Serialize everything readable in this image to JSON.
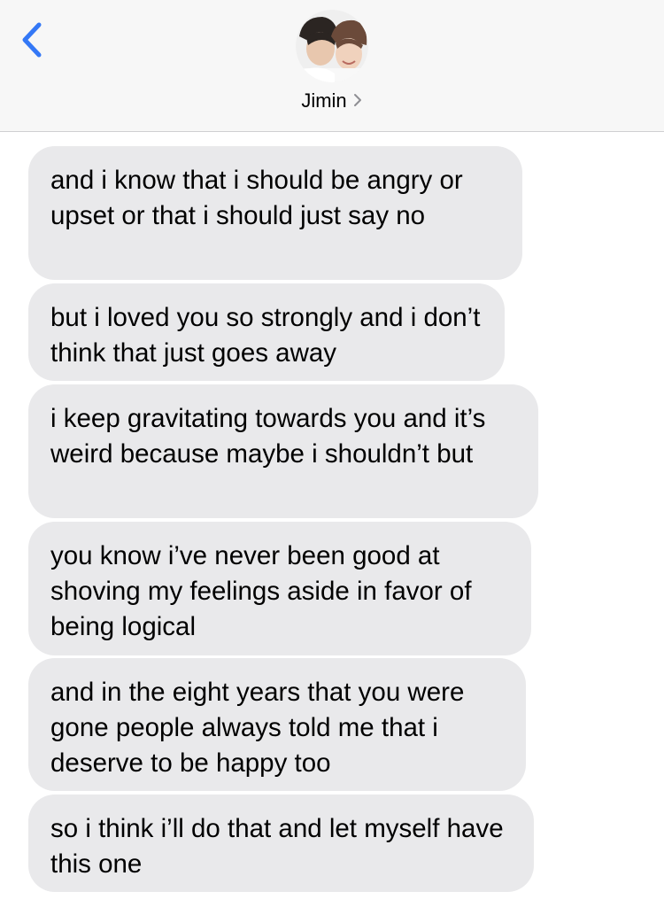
{
  "header": {
    "back_icon": "chevron-left-icon",
    "contact_name": "Jimin",
    "contact_chevron_icon": "chevron-right-icon",
    "accent_color": "#3478f6"
  },
  "messages": [
    {
      "sender": "incoming",
      "text": "and i know that i should be angry or upset or that i should just say no"
    },
    {
      "sender": "incoming",
      "text": "but i loved you so strongly and i don’t think that just goes away"
    },
    {
      "sender": "incoming",
      "text": "i keep gravitating towards you and it’s weird because maybe i shouldn’t but"
    },
    {
      "sender": "incoming",
      "text": "you know i’ve never been good at shoving my feelings aside in favor of being logical"
    },
    {
      "sender": "incoming",
      "text": "and in the eight years that you were gone people always told me that i deserve to be happy too"
    },
    {
      "sender": "incoming",
      "text": "so i think i’ll do that and let myself have this one"
    }
  ],
  "colors": {
    "incoming_bubble": "#e9e9eb",
    "header_bg": "#f7f7f7"
  }
}
